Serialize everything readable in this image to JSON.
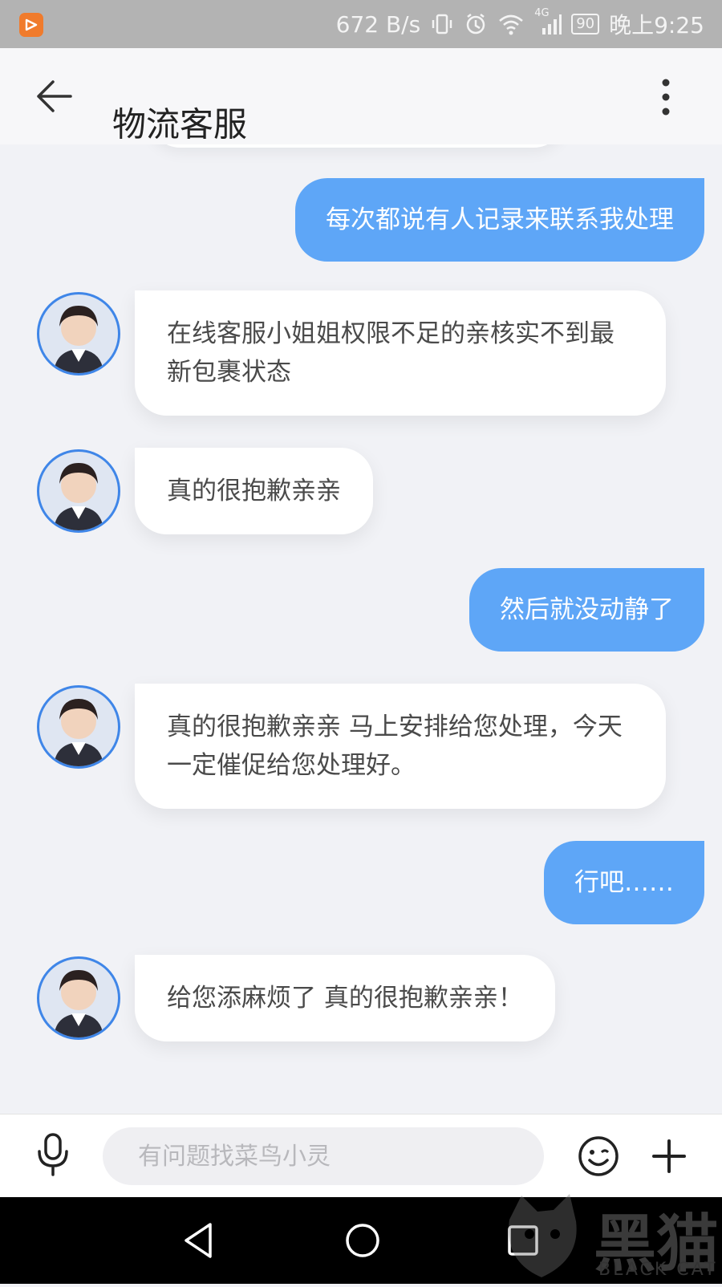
{
  "status_bar": {
    "net_speed": "672 B/s",
    "signal_label": "4G",
    "battery": "90",
    "time": "晚上9:25"
  },
  "header": {
    "title": "物流客服",
    "icons": {
      "back": "arrow-left-icon",
      "more": "more-vertical-icon"
    }
  },
  "messages": [
    {
      "side": "right",
      "text": "每次都说有人记录来联系我处理"
    },
    {
      "side": "left",
      "text": "在线客服小姐姐权限不足的亲核实不到最新包裹状态"
    },
    {
      "side": "left",
      "text": "真的很抱歉亲亲"
    },
    {
      "side": "right",
      "text": "然后就没动静了"
    },
    {
      "side": "left",
      "text": "真的很抱歉亲亲 马上安排给您处理，今天一定催促给您处理好。"
    },
    {
      "side": "right",
      "text": "行吧……"
    },
    {
      "side": "left",
      "text": "给您添麻烦了 真的很抱歉亲亲！"
    }
  ],
  "input_bar": {
    "placeholder": "有问题找菜鸟小灵",
    "icons": {
      "voice": "microphone-icon",
      "emoji": "emoji-icon",
      "more": "plus-icon"
    }
  },
  "watermark": {
    "cn": "黑猫",
    "en": "BLACK CAT"
  },
  "colors": {
    "bubble_user": "#5ea6f7",
    "bubble_agent": "#ffffff",
    "chat_bg": "#f1f2f6",
    "avatar_ring": "#3f86e8"
  }
}
